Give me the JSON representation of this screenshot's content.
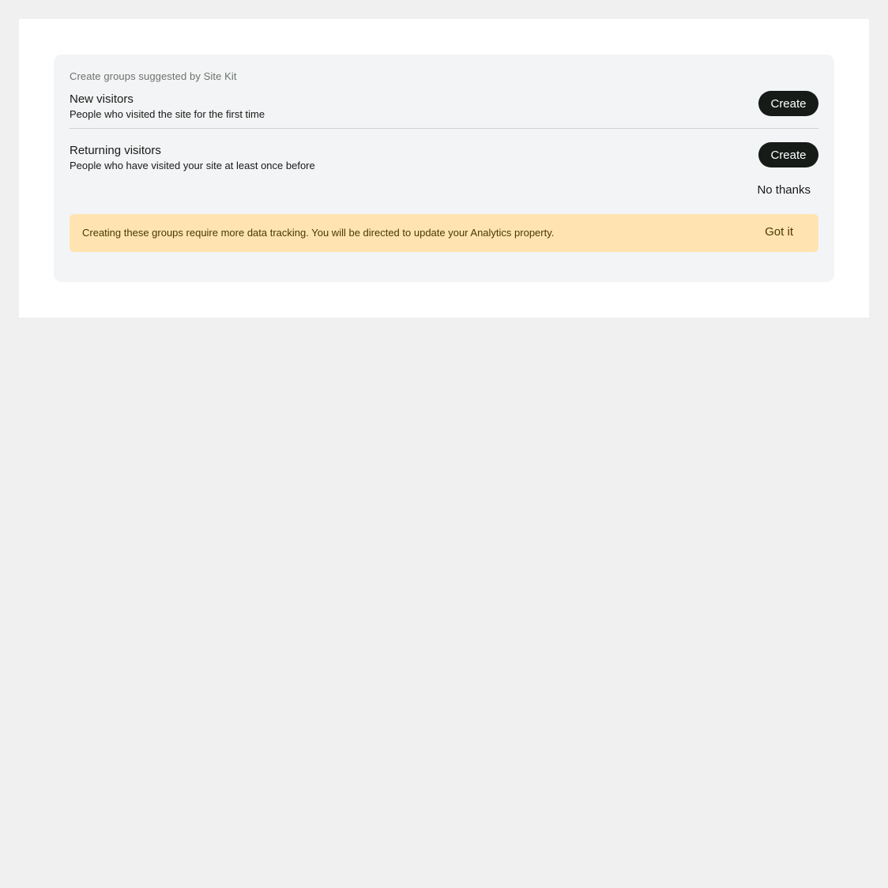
{
  "panel": {
    "heading": "Create groups suggested by Site Kit"
  },
  "groups": [
    {
      "title": "New visitors",
      "description": "People who visited the site for the first time",
      "button_label": "Create"
    },
    {
      "title": "Returning visitors",
      "description": "People who have visited your site at least once before",
      "button_label": "Create"
    }
  ],
  "actions": {
    "dismiss_label": "No thanks"
  },
  "notice": {
    "text": "Creating these groups require more data tracking. You will be directed to update your Analytics property.",
    "acknowledge_label": "Got it"
  },
  "colors": {
    "page_background": "#f0f0f0",
    "canvas_background": "#ffffff",
    "panel_background": "#f3f4f5",
    "primary_button": "#161b18",
    "notice_background": "#ffe4b1"
  }
}
